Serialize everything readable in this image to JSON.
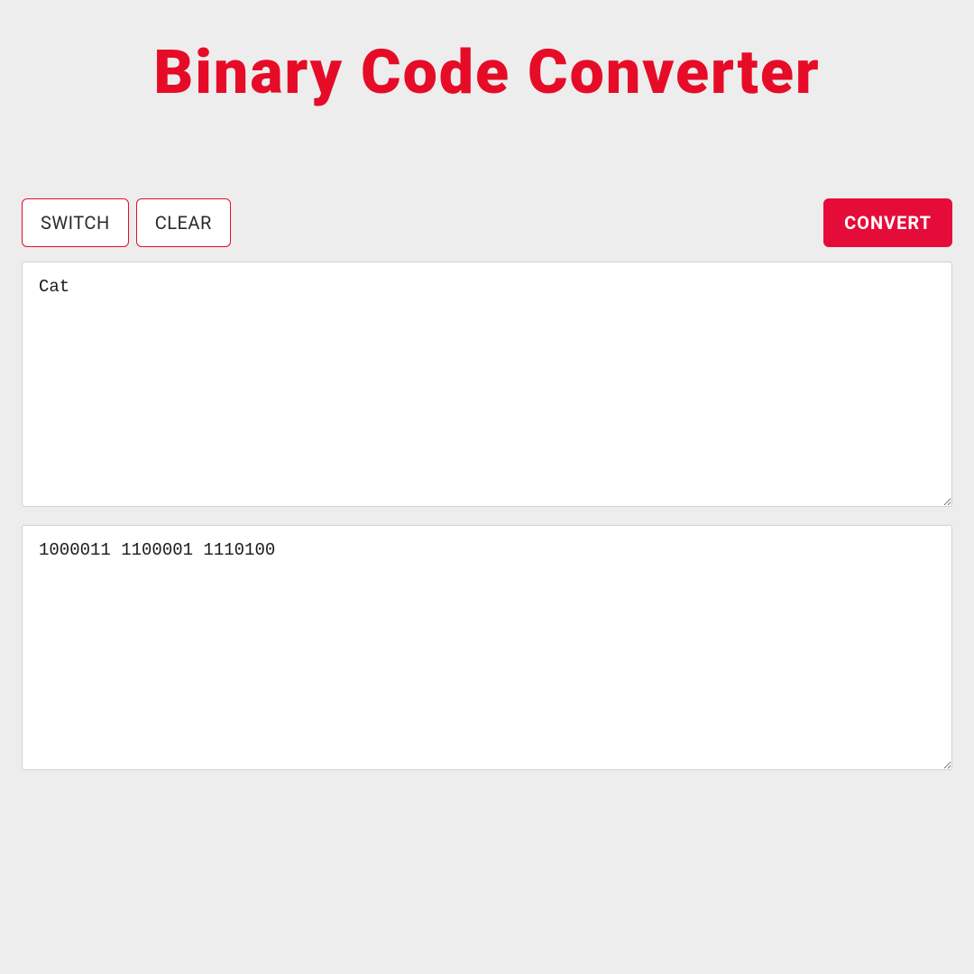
{
  "header": {
    "title": "Binary Code Converter"
  },
  "toolbar": {
    "switch_label": "SWITCH",
    "clear_label": "CLEAR",
    "convert_label": "CONVERT"
  },
  "input_area": {
    "value": "Cat",
    "placeholder": ""
  },
  "output_area": {
    "value": "1000011 1100001 1110100",
    "placeholder": ""
  },
  "colors": {
    "accent": "#e60c27",
    "accent_fill": "#e60c3a",
    "bg": "#ededed",
    "panel": "#ffffff"
  }
}
